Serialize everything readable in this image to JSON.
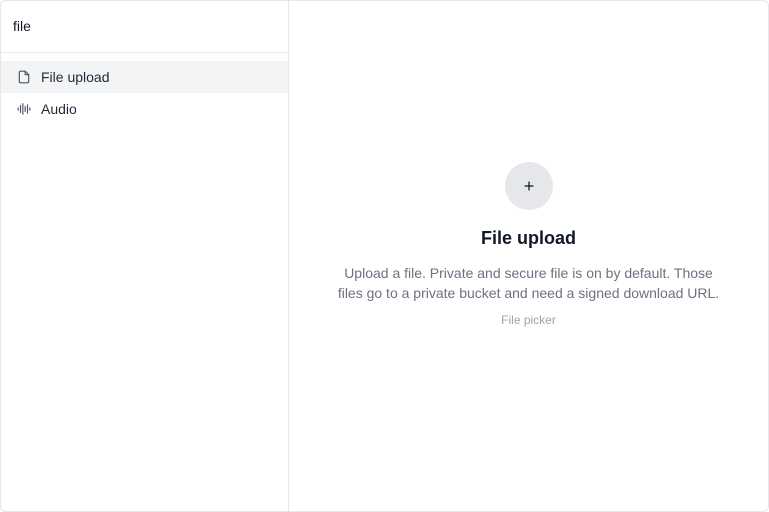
{
  "search": {
    "value": "file",
    "placeholder": ""
  },
  "items": [
    {
      "label": "File upload",
      "icon": "file-icon",
      "active": true
    },
    {
      "label": "Audio",
      "icon": "audio-waveform-icon",
      "active": false
    }
  ],
  "detail": {
    "icon": "plus-icon",
    "title": "File upload",
    "description": "Upload a file. Private and secure file is on by default. Those files go to a private bucket and need a signed download URL.",
    "meta": "File picker"
  },
  "colors": {
    "border": "#e5e7eb",
    "active_bg": "#f3f4f6",
    "text_primary": "#111827",
    "text_secondary": "#6b7280",
    "text_muted": "#9ca3af"
  }
}
